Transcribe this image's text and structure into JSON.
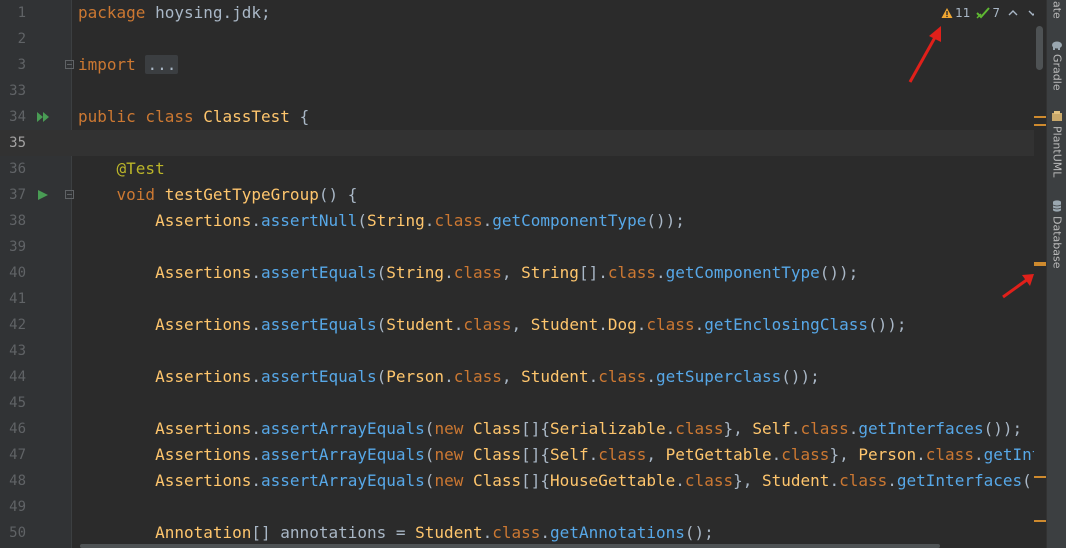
{
  "editor": {
    "gutter": [
      {
        "num": "1"
      },
      {
        "num": "2"
      },
      {
        "num": "3"
      },
      {
        "num": "33"
      },
      {
        "num": "34"
      },
      {
        "num": "35"
      },
      {
        "num": "36"
      },
      {
        "num": "37"
      },
      {
        "num": "38"
      },
      {
        "num": "39"
      },
      {
        "num": "40"
      },
      {
        "num": "41"
      },
      {
        "num": "42"
      },
      {
        "num": "43"
      },
      {
        "num": "44"
      },
      {
        "num": "45"
      },
      {
        "num": "46"
      },
      {
        "num": "47"
      },
      {
        "num": "48"
      },
      {
        "num": "49"
      },
      {
        "num": "50"
      }
    ],
    "lines": [
      {
        "indent": "",
        "t": [
          {
            "k": "kw",
            "s": "package "
          },
          {
            "k": "plain",
            "s": "hoysing.jdk;"
          }
        ]
      },
      {
        "indent": "",
        "t": []
      },
      {
        "indent": "",
        "t": [
          {
            "k": "kw",
            "s": "import "
          },
          {
            "k": "dots",
            "s": "..."
          }
        ]
      },
      {
        "indent": "",
        "t": []
      },
      {
        "indent": "",
        "t": [
          {
            "k": "kw",
            "s": "public class "
          },
          {
            "k": "fn",
            "s": "ClassTest"
          },
          {
            "k": "plain",
            "s": " {"
          }
        ]
      },
      {
        "indent": "",
        "t": []
      },
      {
        "indent": "    ",
        "t": [
          {
            "k": "ann",
            "s": "@Test"
          }
        ]
      },
      {
        "indent": "    ",
        "t": [
          {
            "k": "kw",
            "s": "void "
          },
          {
            "k": "fn",
            "s": "testGetTypeGroup"
          },
          {
            "k": "plain",
            "s": "() {"
          }
        ]
      },
      {
        "indent": "        ",
        "t": [
          {
            "k": "fn",
            "s": "Assertions"
          },
          {
            "k": "plain",
            "s": "."
          },
          {
            "k": "mcall",
            "s": "assertNull"
          },
          {
            "k": "plain",
            "s": "("
          },
          {
            "k": "fn",
            "s": "String"
          },
          {
            "k": "plain",
            "s": "."
          },
          {
            "k": "kw",
            "s": "class"
          },
          {
            "k": "plain",
            "s": "."
          },
          {
            "k": "mcall",
            "s": "getComponentType"
          },
          {
            "k": "plain",
            "s": "());"
          }
        ]
      },
      {
        "indent": "",
        "t": []
      },
      {
        "indent": "        ",
        "t": [
          {
            "k": "fn",
            "s": "Assertions"
          },
          {
            "k": "plain",
            "s": "."
          },
          {
            "k": "mcall",
            "s": "assertEquals"
          },
          {
            "k": "plain",
            "s": "("
          },
          {
            "k": "fn",
            "s": "String"
          },
          {
            "k": "plain",
            "s": "."
          },
          {
            "k": "kw",
            "s": "class"
          },
          {
            "k": "plain",
            "s": ", "
          },
          {
            "k": "fn",
            "s": "String"
          },
          {
            "k": "plain",
            "s": "[]."
          },
          {
            "k": "kw",
            "s": "class"
          },
          {
            "k": "plain",
            "s": "."
          },
          {
            "k": "mcall",
            "s": "getComponentType"
          },
          {
            "k": "plain",
            "s": "());"
          }
        ]
      },
      {
        "indent": "",
        "t": []
      },
      {
        "indent": "        ",
        "t": [
          {
            "k": "fn",
            "s": "Assertions"
          },
          {
            "k": "plain",
            "s": "."
          },
          {
            "k": "mcall",
            "s": "assertEquals"
          },
          {
            "k": "plain",
            "s": "("
          },
          {
            "k": "fn",
            "s": "Student"
          },
          {
            "k": "plain",
            "s": "."
          },
          {
            "k": "kw",
            "s": "class"
          },
          {
            "k": "plain",
            "s": ", "
          },
          {
            "k": "fn",
            "s": "Student"
          },
          {
            "k": "plain",
            "s": "."
          },
          {
            "k": "fn",
            "s": "Dog"
          },
          {
            "k": "plain",
            "s": "."
          },
          {
            "k": "kw",
            "s": "class"
          },
          {
            "k": "plain",
            "s": "."
          },
          {
            "k": "mcall",
            "s": "getEnclosingClass"
          },
          {
            "k": "plain",
            "s": "());"
          }
        ]
      },
      {
        "indent": "",
        "t": []
      },
      {
        "indent": "        ",
        "t": [
          {
            "k": "fn",
            "s": "Assertions"
          },
          {
            "k": "plain",
            "s": "."
          },
          {
            "k": "mcall",
            "s": "assertEquals"
          },
          {
            "k": "plain",
            "s": "("
          },
          {
            "k": "fn",
            "s": "Person"
          },
          {
            "k": "plain",
            "s": "."
          },
          {
            "k": "kw",
            "s": "class"
          },
          {
            "k": "plain",
            "s": ", "
          },
          {
            "k": "fn",
            "s": "Student"
          },
          {
            "k": "plain",
            "s": "."
          },
          {
            "k": "kw",
            "s": "class"
          },
          {
            "k": "plain",
            "s": "."
          },
          {
            "k": "mcall",
            "s": "getSuperclass"
          },
          {
            "k": "plain",
            "s": "());"
          }
        ]
      },
      {
        "indent": "",
        "t": []
      },
      {
        "indent": "        ",
        "t": [
          {
            "k": "fn",
            "s": "Assertions"
          },
          {
            "k": "plain",
            "s": "."
          },
          {
            "k": "mcall",
            "s": "assertArrayEquals"
          },
          {
            "k": "plain",
            "s": "("
          },
          {
            "k": "kw",
            "s": "new "
          },
          {
            "k": "fn",
            "s": "Class"
          },
          {
            "k": "plain",
            "s": "[]{"
          },
          {
            "k": "fn",
            "s": "Serializable"
          },
          {
            "k": "plain",
            "s": "."
          },
          {
            "k": "kw",
            "s": "class"
          },
          {
            "k": "plain",
            "s": "}, "
          },
          {
            "k": "fn",
            "s": "Self"
          },
          {
            "k": "plain",
            "s": "."
          },
          {
            "k": "kw",
            "s": "class"
          },
          {
            "k": "plain",
            "s": "."
          },
          {
            "k": "mcall",
            "s": "getInterfaces"
          },
          {
            "k": "plain",
            "s": "());"
          }
        ]
      },
      {
        "indent": "        ",
        "t": [
          {
            "k": "fn",
            "s": "Assertions"
          },
          {
            "k": "plain",
            "s": "."
          },
          {
            "k": "mcall",
            "s": "assertArrayEquals"
          },
          {
            "k": "plain",
            "s": "("
          },
          {
            "k": "kw",
            "s": "new "
          },
          {
            "k": "fn",
            "s": "Class"
          },
          {
            "k": "plain",
            "s": "[]{"
          },
          {
            "k": "fn",
            "s": "Self"
          },
          {
            "k": "plain",
            "s": "."
          },
          {
            "k": "kw",
            "s": "class"
          },
          {
            "k": "plain",
            "s": ", "
          },
          {
            "k": "fn",
            "s": "PetGettable"
          },
          {
            "k": "plain",
            "s": "."
          },
          {
            "k": "kw",
            "s": "class"
          },
          {
            "k": "plain",
            "s": "}, "
          },
          {
            "k": "fn",
            "s": "Person"
          },
          {
            "k": "plain",
            "s": "."
          },
          {
            "k": "kw",
            "s": "class"
          },
          {
            "k": "plain",
            "s": "."
          },
          {
            "k": "mcall",
            "s": "getInterfaces"
          },
          {
            "k": "plain",
            "s": "());"
          }
        ]
      },
      {
        "indent": "        ",
        "t": [
          {
            "k": "fn",
            "s": "Assertions"
          },
          {
            "k": "plain",
            "s": "."
          },
          {
            "k": "mcall",
            "s": "assertArrayEquals"
          },
          {
            "k": "plain",
            "s": "("
          },
          {
            "k": "kw",
            "s": "new "
          },
          {
            "k": "fn",
            "s": "Class"
          },
          {
            "k": "plain",
            "s": "[]{"
          },
          {
            "k": "fn",
            "s": "HouseGettable"
          },
          {
            "k": "plain",
            "s": "."
          },
          {
            "k": "kw",
            "s": "class"
          },
          {
            "k": "plain",
            "s": "}, "
          },
          {
            "k": "fn",
            "s": "Student"
          },
          {
            "k": "plain",
            "s": "."
          },
          {
            "k": "kw",
            "s": "class"
          },
          {
            "k": "plain",
            "s": "."
          },
          {
            "k": "mcall",
            "s": "getInterfaces"
          },
          {
            "k": "plain",
            "s": "());"
          }
        ]
      },
      {
        "indent": "",
        "t": []
      },
      {
        "indent": "        ",
        "t": [
          {
            "k": "fn",
            "s": "Annotation"
          },
          {
            "k": "plain",
            "s": "[] annotations = "
          },
          {
            "k": "fn",
            "s": "Student"
          },
          {
            "k": "plain",
            "s": "."
          },
          {
            "k": "kw",
            "s": "class"
          },
          {
            "k": "plain",
            "s": "."
          },
          {
            "k": "mcall",
            "s": "getAnnotations"
          },
          {
            "k": "plain",
            "s": "();"
          }
        ]
      }
    ]
  },
  "inspections": {
    "warnings": "11",
    "weak_warnings": "7",
    "colors": {
      "warning": "#f0a732",
      "weak": "#5fb832"
    }
  },
  "right_toolbar": {
    "top_partial": "date",
    "tabs": [
      {
        "label": "Gradle",
        "icon": "elephant-icon"
      },
      {
        "label": "PlantUML",
        "icon": "plantuml-icon"
      },
      {
        "label": "Database",
        "icon": "database-icon"
      }
    ]
  },
  "colors": {
    "caret_line": "#323232",
    "stripe_mark": "#ce8a2e",
    "arrow": "#e0201a"
  }
}
